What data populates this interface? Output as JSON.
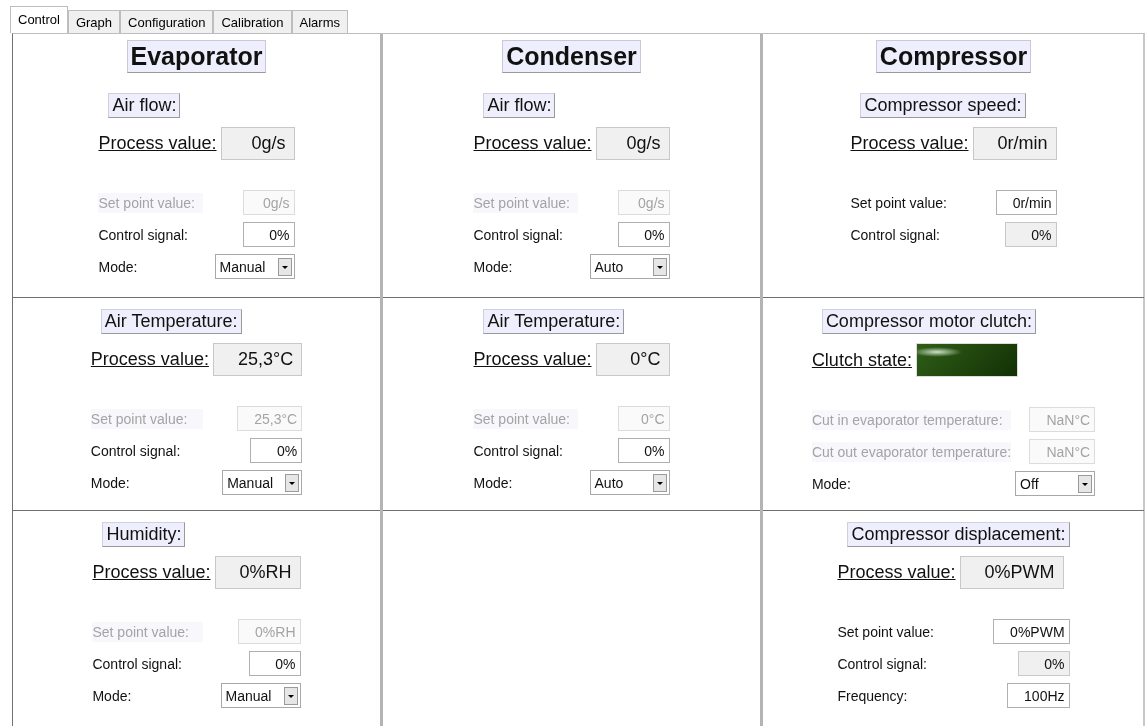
{
  "tabs": [
    {
      "label": "Control",
      "selected": true
    },
    {
      "label": "Graph",
      "selected": false
    },
    {
      "label": "Configuration",
      "selected": false
    },
    {
      "label": "Calibration",
      "selected": false
    },
    {
      "label": "Alarms",
      "selected": false
    }
  ],
  "columns": [
    {
      "title": "Evaporator",
      "sections": [
        {
          "title": "Air flow:",
          "process": {
            "kind": "readout",
            "label": "Process value:",
            "value": "0g/s"
          },
          "rows": [
            {
              "kind": "readout",
              "label": "Set point value:",
              "value": "0g/s",
              "disabled": true
            },
            {
              "kind": "input",
              "label": "Control signal:",
              "value": "0%",
              "disabled": false
            },
            {
              "kind": "select",
              "label": "Mode:",
              "value": "Manual",
              "disabled": false
            }
          ]
        },
        {
          "title": "Air Temperature:",
          "process": {
            "kind": "readout",
            "label": "Process value:",
            "value": "25,3°C"
          },
          "rows": [
            {
              "kind": "readout",
              "label": "Set point value:",
              "value": "25,3°C",
              "disabled": true
            },
            {
              "kind": "input",
              "label": "Control signal:",
              "value": "0%",
              "disabled": false
            },
            {
              "kind": "select",
              "label": "Mode:",
              "value": "Manual",
              "disabled": false
            }
          ]
        },
        {
          "title": "Humidity:",
          "process": {
            "kind": "readout",
            "label": "Process value:",
            "value": "0%RH"
          },
          "rows": [
            {
              "kind": "readout",
              "label": "Set point value:",
              "value": "0%RH",
              "disabled": true
            },
            {
              "kind": "input",
              "label": "Control signal:",
              "value": "0%",
              "disabled": false
            },
            {
              "kind": "select",
              "label": "Mode:",
              "value": "Manual",
              "disabled": false
            }
          ]
        }
      ]
    },
    {
      "title": "Condenser",
      "sections": [
        {
          "title": "Air flow:",
          "process": {
            "kind": "readout",
            "label": "Process value:",
            "value": "0g/s"
          },
          "rows": [
            {
              "kind": "readout",
              "label": "Set point value:",
              "value": "0g/s",
              "disabled": true
            },
            {
              "kind": "input",
              "label": "Control signal:",
              "value": "0%",
              "disabled": false
            },
            {
              "kind": "select",
              "label": "Mode:",
              "value": "Auto",
              "disabled": false
            }
          ]
        },
        {
          "title": "Air Temperature:",
          "process": {
            "kind": "readout",
            "label": "Process value:",
            "value": "0°C"
          },
          "rows": [
            {
              "kind": "readout",
              "label": "Set point value:",
              "value": "0°C",
              "disabled": true
            },
            {
              "kind": "input",
              "label": "Control signal:",
              "value": "0%",
              "disabled": false
            },
            {
              "kind": "select",
              "label": "Mode:",
              "value": "Auto",
              "disabled": false
            }
          ]
        }
      ]
    },
    {
      "title": "Compressor",
      "sections": [
        {
          "title": "Compressor speed:",
          "process": {
            "kind": "readout",
            "label": "Process value:",
            "value": "0r/min"
          },
          "rows": [
            {
              "kind": "input",
              "label": "Set point value:",
              "value": "0r/min",
              "disabled": false
            },
            {
              "kind": "readout",
              "label": "Control signal:",
              "value": "0%",
              "disabled": false
            }
          ]
        },
        {
          "title": "Compressor motor clutch:",
          "process": {
            "kind": "lamp",
            "label": "Clutch state:",
            "on": true
          },
          "rows": [
            {
              "kind": "readout",
              "label": "Cut in evaporator temperature:",
              "value": "NaN°C",
              "disabled": true
            },
            {
              "kind": "readout",
              "label": "Cut out evaporator temperature:",
              "value": "NaN°C",
              "disabled": true
            },
            {
              "kind": "select",
              "label": "Mode:",
              "value": "Off",
              "disabled": false
            }
          ]
        },
        {
          "title": "Compressor displacement:",
          "process": {
            "kind": "readout",
            "label": "Process value:",
            "value": "0%PWM"
          },
          "rows": [
            {
              "kind": "input",
              "label": "Set point value:",
              "value": "0%PWM",
              "disabled": false
            },
            {
              "kind": "readout",
              "label": "Control signal:",
              "value": "0%",
              "disabled": false
            },
            {
              "kind": "input",
              "label": "Frequency:",
              "value": "100Hz",
              "disabled": false
            }
          ]
        }
      ]
    }
  ]
}
